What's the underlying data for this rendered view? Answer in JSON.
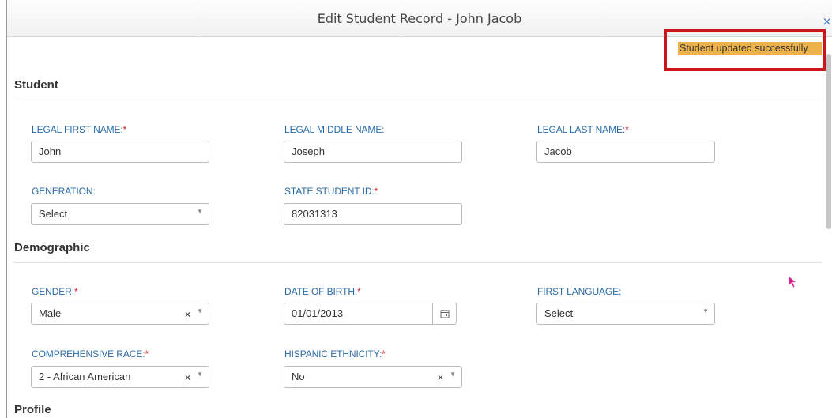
{
  "header": {
    "title": "Edit Student Record - John Jacob",
    "close_glyph": "×"
  },
  "toast": {
    "message": "Student updated successfully",
    "color": "#eeb24a",
    "highlight_border": "#c8161b"
  },
  "sections": {
    "student": "Student",
    "demographic": "Demographic",
    "profile": "Profile"
  },
  "fields": {
    "first_name": {
      "label": "LEGAL FIRST NAME:",
      "required": "*",
      "value": "John"
    },
    "middle_name": {
      "label": "LEGAL MIDDLE NAME:",
      "value": "Joseph"
    },
    "last_name": {
      "label": "LEGAL LAST NAME:",
      "required": "*",
      "value": "Jacob"
    },
    "generation": {
      "label": "GENERATION:",
      "value": "Select"
    },
    "state_student_id": {
      "label": "STATE STUDENT ID:",
      "required": "*",
      "value": "82031313"
    },
    "gender": {
      "label": "GENDER:",
      "required": "*",
      "value": "Male"
    },
    "date_of_birth": {
      "label": "DATE OF BIRTH:",
      "required": "*",
      "value": "01/01/2013"
    },
    "first_language": {
      "label": "FIRST LANGUAGE:",
      "value": "Select"
    },
    "comprehensive_race": {
      "label": "COMPREHENSIVE RACE:",
      "required": "*",
      "value": "2 - African American"
    },
    "hispanic_ethnicity": {
      "label": "HISPANIC ETHNICITY:",
      "required": "*",
      "value": "No"
    }
  },
  "glyphs": {
    "clear": "×",
    "dropdown": "▼"
  },
  "colors": {
    "label_blue": "#2a6aa6",
    "required_red": "#d0232b",
    "cursor": "#d6248f"
  }
}
